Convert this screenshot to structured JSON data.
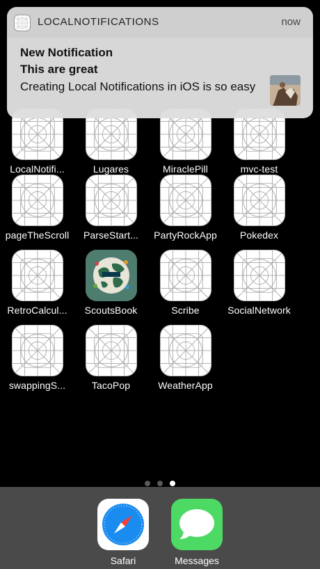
{
  "notification": {
    "app_name": "LOCALNOTIFICATIONS",
    "time": "now",
    "title": "New Notification",
    "subtitle": "This are great",
    "body": "Creating Local Notifications in iOS is so easy"
  },
  "apps": [
    {
      "label": "LocalNotifi...",
      "icon": "placeholder-grid-icon"
    },
    {
      "label": "Lugares",
      "icon": "placeholder-grid-icon"
    },
    {
      "label": "MiraclePill",
      "icon": "placeholder-grid-icon"
    },
    {
      "label": "mvc-test",
      "icon": "placeholder-grid-icon"
    },
    {
      "label": "pageTheScroll",
      "icon": "placeholder-grid-icon"
    },
    {
      "label": "ParseStart...",
      "icon": "placeholder-grid-icon"
    },
    {
      "label": "PartyRockApp",
      "icon": "placeholder-grid-icon"
    },
    {
      "label": "Pokedex",
      "icon": "placeholder-grid-icon"
    },
    {
      "label": "RetroCalcul...",
      "icon": "placeholder-grid-icon"
    },
    {
      "label": "ScoutsBook",
      "icon": "scouts-globe-icon"
    },
    {
      "label": "Scribe",
      "icon": "placeholder-grid-icon"
    },
    {
      "label": "SocialNetwork",
      "icon": "placeholder-grid-icon"
    },
    {
      "label": "swappingS...",
      "icon": "placeholder-grid-icon"
    },
    {
      "label": "TacoPop",
      "icon": "placeholder-grid-icon"
    },
    {
      "label": "WeatherApp",
      "icon": "placeholder-grid-icon"
    }
  ],
  "page_dots": {
    "count": 3,
    "active_index": 2
  },
  "dock": [
    {
      "label": "Safari",
      "icon": "safari-compass-icon"
    },
    {
      "label": "Messages",
      "icon": "messages-bubble-icon"
    }
  ],
  "colors": {
    "background": "#000000",
    "dock": "#4a4a4a",
    "messages_green": "#4cd964",
    "safari_blue": "#1a8cf0"
  }
}
